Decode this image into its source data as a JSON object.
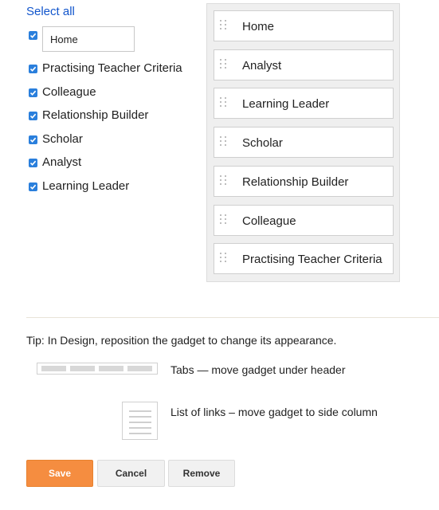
{
  "select_all": "Select all",
  "checklist": [
    {
      "label": "Home",
      "checked": true,
      "editable": true
    },
    {
      "label": "Practising Teacher Criteria",
      "checked": true
    },
    {
      "label": "Colleague",
      "checked": true
    },
    {
      "label": "Relationship Builder",
      "checked": true
    },
    {
      "label": "Scholar",
      "checked": true
    },
    {
      "label": "Analyst",
      "checked": true
    },
    {
      "label": "Learning Leader",
      "checked": true
    }
  ],
  "order_list": [
    "Home",
    "Analyst",
    "Learning Leader",
    "Scholar",
    "Relationship Builder",
    "Colleague",
    "Practising Teacher Criteria"
  ],
  "tip": "Tip: In Design, reposition the gadget to change its appearance.",
  "options": {
    "tabs": "Tabs — move gadget under header",
    "list": "List of links – move gadget to side column"
  },
  "buttons": {
    "save": "Save",
    "cancel": "Cancel",
    "remove": "Remove"
  },
  "colors": {
    "accent": "#f58d40",
    "link": "#1155cc",
    "checkbox": "#2a7fdc"
  }
}
